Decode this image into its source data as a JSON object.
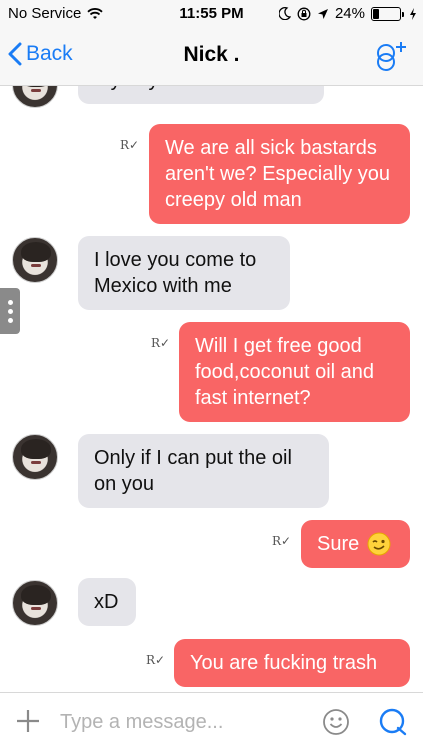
{
  "status_bar": {
    "carrier": "No Service",
    "time": "11:55 PM",
    "battery_percent": "24%",
    "battery_level": 0.24,
    "icons": [
      "wifi-icon",
      "moon-icon",
      "lock-rotation-icon",
      "location-icon",
      "battery-icon",
      "charging-icon"
    ]
  },
  "nav": {
    "back_label": "Back",
    "title": "Nick .",
    "right_icon": "add-contact-icon"
  },
  "messages": [
    {
      "direction": "in",
      "text": "My boyfriend isn't real"
    },
    {
      "direction": "out",
      "text": "We are all sick bastards aren't we? Especially you creepy old man",
      "read_mark": "R✓"
    },
    {
      "direction": "in",
      "text": "I love you come to Mexico with me"
    },
    {
      "direction": "out",
      "text": "Will I get free good food,coconut oil and fast internet?",
      "read_mark": "R✓"
    },
    {
      "direction": "in",
      "text": "Only if I can put the oil on you"
    },
    {
      "direction": "out",
      "text": "Sure",
      "emoji": "winking-face-icon",
      "read_mark": "R✓"
    },
    {
      "direction": "in",
      "text": "xD"
    },
    {
      "direction": "out",
      "text": "You are fucking trash",
      "read_mark": "R✓"
    }
  ],
  "input_bar": {
    "placeholder": "Type a message...",
    "value": "",
    "icons": [
      "plus-icon",
      "emoji-icon",
      "send-icon"
    ]
  },
  "colors": {
    "accent": "#1a7cf5",
    "outgoing_bubble": "#f96565",
    "incoming_bubble": "#e5e5ea"
  }
}
